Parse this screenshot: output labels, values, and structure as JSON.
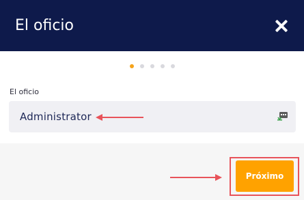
{
  "dialog": {
    "title": "El oficio",
    "close_icon": "close-icon"
  },
  "stepper": {
    "total_steps": 5,
    "current_step": 1,
    "active_color": "#f5a31a",
    "inactive_color": "#d9d9de"
  },
  "occupation_field": {
    "label": "El oficio",
    "value": "Administrator",
    "icon": "password-manager-icon"
  },
  "footer": {
    "next_label": "Próximo"
  },
  "colors": {
    "header_bg": "#0e1a4b",
    "button_bg": "#ffa200",
    "annotation": "#e8535a"
  }
}
